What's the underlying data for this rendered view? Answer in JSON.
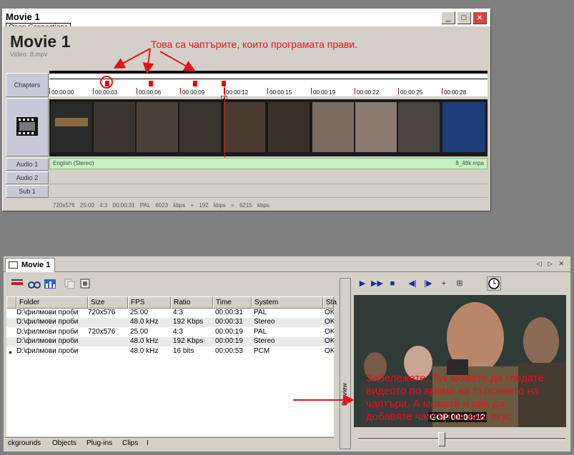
{
  "window": {
    "title": "Movie 1",
    "tooltip": "Open Connections",
    "minimize": "_",
    "maximize": "□",
    "close": "×"
  },
  "movie": {
    "title": "Movie 1",
    "subtitle": "Video: 8.mpv"
  },
  "tracks": {
    "chapters": "Chapters",
    "audio1": "Audio 1",
    "audio2": "Audio 2",
    "sub1": "Sub 1"
  },
  "ruler_ticks": [
    "00:00:00",
    "00:00:03",
    "00:00:06",
    "00:00:09",
    "00:00:12",
    "00:00:15",
    "00:00:19",
    "00:00:22",
    "00:00:25",
    "00:00:28"
  ],
  "audio_track": {
    "language": "English (Stereo)",
    "file": "8_48k.mpa"
  },
  "info_line": "720x576   25.00   4:3   00:00:31   PAL   6023 kbps + 192 kbps = 6215 kbps",
  "annotations": {
    "top": "Това са чаптърите, които програмата прави.",
    "bottom": "Забележете: Тук можете да гледате видеото по време на търсенето на чаптъри. А можете и вие да добавяте чаптър по ваш вкус."
  },
  "lower_panel": {
    "tab": "Movie 1",
    "columns": [
      "Folder",
      "Size",
      "FPS",
      "Ratio",
      "Time",
      "System",
      "Sta"
    ],
    "rows": [
      [
        "D:\\филмови проби",
        "720x576",
        "25.00",
        "4:3",
        "00:00:31",
        "PAL",
        "OK"
      ],
      [
        "D:\\филмови проби",
        "",
        "48.0 kHz",
        "192 Kbps",
        "00:00:31",
        "Stereo",
        "OK"
      ],
      [
        "D:\\филмови проби",
        "720x576",
        "25.00",
        "4:3",
        "00:00:19",
        "PAL",
        "OK"
      ],
      [
        "D:\\филмови проби",
        "",
        "48.0 kHz",
        "192 Kbps",
        "00:00:19",
        "Stereo",
        "OK"
      ],
      [
        "D:\\филмови проби",
        "",
        "48.0 kHz",
        "16 bits",
        "00:00:53",
        "PCM",
        "OK"
      ]
    ],
    "bottom_tabs": [
      "ckgrounds",
      "Objects",
      "Plug-ins",
      "Clips",
      "I"
    ]
  },
  "preview": {
    "label": "Preview",
    "gop": "GOP 00:00:12"
  },
  "colors": {
    "annotation": "#e0141c",
    "audio_track": "#c8f0c0",
    "chapter_marker": "#e00000"
  }
}
